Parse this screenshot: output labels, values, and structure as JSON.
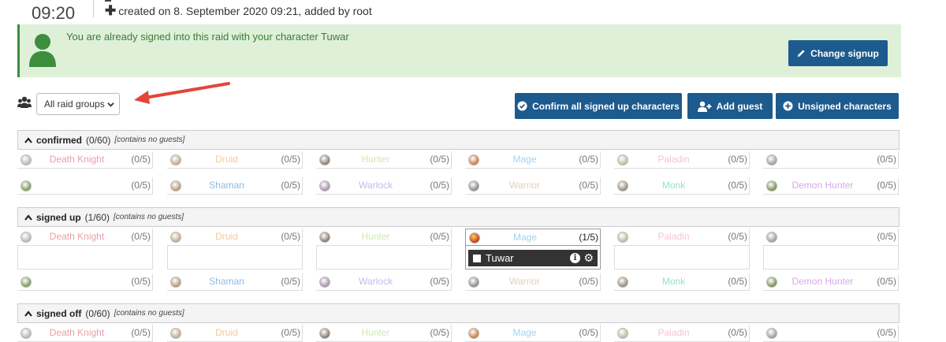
{
  "header": {
    "time": "09:20",
    "created_text": "created on 8. September 2020 09:21, added by root"
  },
  "alert": {
    "message": "You are already signed into this raid with your character Tuwar",
    "change_signup_label": "Change signup"
  },
  "toolbar": {
    "raid_group_select": "All raid groups",
    "confirm_all_label": "Confirm all signed up characters",
    "add_guest_label": "Add guest",
    "unsigned_label": "Unsigned characters"
  },
  "sections": [
    {
      "title": "confirmed",
      "count": "(0/60)",
      "note": "[contains no guests]",
      "row1": [
        {
          "name": "Death Knight",
          "count": "(0/5)"
        },
        {
          "name": "Druid",
          "count": "(0/5)"
        },
        {
          "name": "Hunter",
          "count": "(0/5)"
        },
        {
          "name": "Mage",
          "count": "(0/5)"
        },
        {
          "name": "Paladin",
          "count": "(0/5)"
        },
        {
          "name": "",
          "count": "(0/5)"
        }
      ],
      "row2": [
        {
          "name": "",
          "count": "(0/5)"
        },
        {
          "name": "Shaman",
          "count": "(0/5)"
        },
        {
          "name": "Warlock",
          "count": "(0/5)"
        },
        {
          "name": "Warrior",
          "count": "(0/5)"
        },
        {
          "name": "Monk",
          "count": "(0/5)"
        },
        {
          "name": "Demon Hunter",
          "count": "(0/5)"
        }
      ]
    },
    {
      "title": "signed up",
      "count": "(1/60)",
      "note": "[contains no guests]",
      "row1": [
        {
          "name": "Death Knight",
          "count": "(0/5)"
        },
        {
          "name": "Druid",
          "count": "(0/5)"
        },
        {
          "name": "Hunter",
          "count": "(0/5)"
        },
        {
          "name": "Mage",
          "count": "(1/5)"
        },
        {
          "name": "Paladin",
          "count": "(0/5)"
        },
        {
          "name": "",
          "count": "(0/5)"
        }
      ],
      "row2": [
        {
          "name": "",
          "count": "(0/5)"
        },
        {
          "name": "Shaman",
          "count": "(0/5)"
        },
        {
          "name": "Warlock",
          "count": "(0/5)"
        },
        {
          "name": "Warrior",
          "count": "(0/5)"
        },
        {
          "name": "Monk",
          "count": "(0/5)"
        },
        {
          "name": "Demon Hunter",
          "count": "(0/5)"
        }
      ],
      "player": "Tuwar"
    },
    {
      "title": "signed off",
      "count": "(0/60)",
      "note": "[contains no guests]",
      "row1": [
        {
          "name": "Death Knight",
          "count": "(0/5)"
        },
        {
          "name": "Druid",
          "count": "(0/5)"
        },
        {
          "name": "Hunter",
          "count": "(0/5)"
        },
        {
          "name": "Mage",
          "count": "(0/5)"
        },
        {
          "name": "Paladin",
          "count": "(0/5)"
        },
        {
          "name": "",
          "count": "(0/5)"
        }
      ]
    }
  ],
  "class_colors": {
    "Death Knight": "#e8a0a8",
    "Druid": "#f5c89a",
    "Hunter": "#cfe8b8",
    "Mage": "#9fd4f0",
    "Paladin": "#f5c4d4",
    "Rogue": "#faf4a8",
    "Shaman": "#8fb8e8",
    "Warlock": "#c0bce8",
    "Warrior": "#e0d0bc",
    "Monk": "#8fe8c0",
    "Demon Hunter": "#d6a8e8",
    "Priest": "#eeeeee"
  },
  "colors": {
    "primary_button": "#1d5a8e",
    "alert_bg": "#dff0d8",
    "alert_text": "#3c7a3c"
  }
}
